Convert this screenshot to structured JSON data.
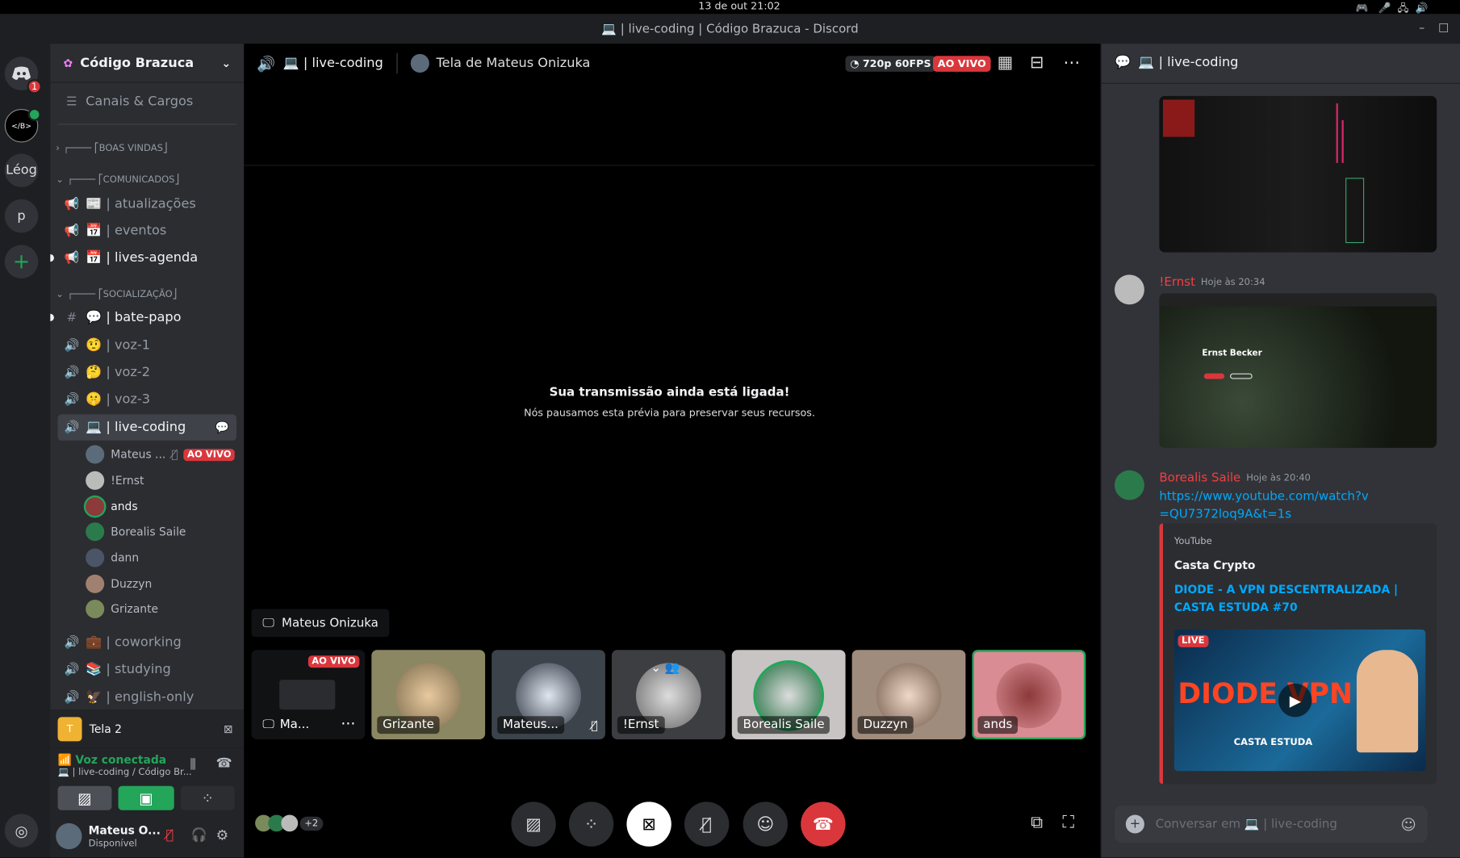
{
  "os": {
    "datetime": "13 de out  21:02"
  },
  "window": {
    "title": "💻 | live-coding | Código Brazuca - Discord"
  },
  "servers": {
    "badge": "1",
    "items": [
      "Léog",
      "p"
    ],
    "add": "+"
  },
  "guild": {
    "name": "Código Brazuca",
    "roles": "Canais & Cargos"
  },
  "categories": [
    "┌──── ⎡BOAS VINDAS⎦",
    "┌──── ⎡COMUNICADOS⎦",
    "┌──── ⎡SOCIALIZAÇÃO⎦"
  ],
  "channels": [
    {
      "icon": "📢",
      "label": "📰 | atualizações"
    },
    {
      "icon": "📢",
      "label": "📅 | eventos"
    },
    {
      "icon": "📢",
      "label": "📅 | lives-agenda"
    },
    {
      "icon": "#",
      "label": "💬 | bate-papo"
    },
    {
      "icon": "🔊",
      "label": "🤨 | voz-1"
    },
    {
      "icon": "🔊",
      "label": "🤔 | voz-2"
    },
    {
      "icon": "🔊",
      "label": "🤫 | voz-3"
    },
    {
      "icon": "🔊",
      "label": "💻 | live-coding"
    },
    {
      "icon": "🔊",
      "label": "💼 | coworking"
    },
    {
      "icon": "🔊",
      "label": "📚 | studying"
    },
    {
      "icon": "🔊",
      "label": "🦅 | english-only"
    }
  ],
  "voice_users": [
    "Mateus ...",
    "!Ernst",
    "ands",
    "Borealis Saile",
    "dann",
    "Duzzyn",
    "Grizante"
  ],
  "live_badge": "AO VIVO",
  "stream_panel": {
    "title": "Tela 2"
  },
  "voice_panel": {
    "status": "Voz conectada",
    "channel": "💻 | live-coding / Código Br..."
  },
  "user": {
    "name": "Mateus O...",
    "status": "Disponível"
  },
  "stage": {
    "channel": "💻 | live-coding",
    "streamer": "Tela de Mateus Onizuka",
    "quality": "720p 60FPS",
    "live": "AO VIVO",
    "paused_title": "Sua transmissão ainda está ligada!",
    "paused_sub": "Nós pausamos esta prévia para preservar seus recursos.",
    "stream_owner": "Mateus Onizuka",
    "more_count": "+2"
  },
  "tiles": [
    {
      "name": "Ma...",
      "bg": "#111214"
    },
    {
      "name": "Grizante",
      "bg": "#8a8762"
    },
    {
      "name": "Mateus...",
      "bg": "#3c434a"
    },
    {
      "name": "!Ernst",
      "bg": "#3c3e42"
    },
    {
      "name": "Borealis Saile",
      "bg": "#c9c4c4"
    },
    {
      "name": "Duzzyn",
      "bg": "#a08c7c"
    },
    {
      "name": "ands",
      "bg": "#d98c93"
    }
  ],
  "chat": {
    "channel": "💻 | live-coding",
    "msgs": [
      {
        "user": "!Ernst",
        "time": "Hoje às 20:34",
        "img_text": "Ernst Becker"
      },
      {
        "user": "Borealis Saile",
        "time": "Hoje às 20:40",
        "link": "https://www.youtube.com/watch?v=QU7372loq9A&t=1s",
        "embed_provider": "YouTube",
        "embed_author": "Casta Crypto",
        "embed_title": "DIODE - A VPN DESCENTRALIZADA | CASTA ESTUDA #70",
        "thumb_live": "LIVE",
        "thumb_main": "DIODE VPN",
        "thumb_sub": "CASTA ESTUDA"
      }
    ],
    "input_placeholder": "Conversar em 💻 | live-coding"
  },
  "colors": {
    "accent": "#5865f2",
    "live": "#da373c",
    "green": "#23a55a",
    "red": "#da373c",
    "link": "#00a8fc"
  }
}
